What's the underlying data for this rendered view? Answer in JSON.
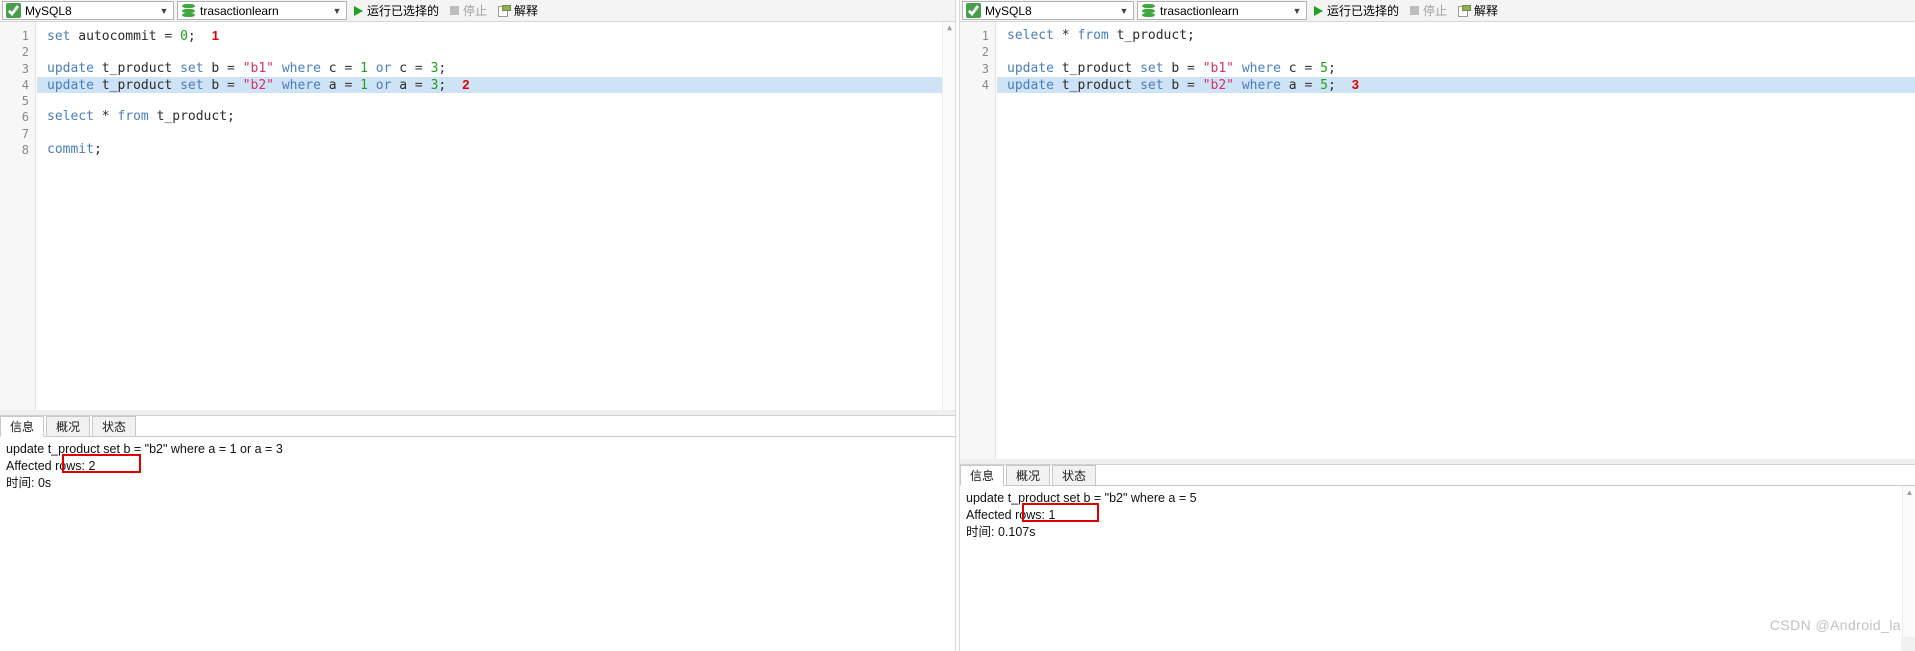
{
  "left_window": {
    "toolbar": {
      "connection": {
        "label": "MySQL8",
        "icon": "mysql-icon"
      },
      "database": {
        "label": "trasactionlearn",
        "icon": "database-icon"
      },
      "run_selected": {
        "label": "运行已选择的",
        "icon": "play-icon"
      },
      "stop": {
        "label": "停止",
        "icon": "stop-icon"
      },
      "explain": {
        "label": "解释",
        "icon": "explain-icon"
      }
    },
    "editor": {
      "line_numbers": [
        "1",
        "2",
        "3",
        "4",
        "5",
        "6",
        "7",
        "8"
      ],
      "lines": [
        {
          "n": 1,
          "tokens": [
            {
              "t": "set",
              "c": "kw"
            },
            {
              "t": " autocommit ",
              "c": "plain"
            },
            {
              "t": "= ",
              "c": "op"
            },
            {
              "t": "0",
              "c": "num"
            },
            {
              "t": ";",
              "c": "plain"
            }
          ],
          "annotation": "1",
          "highlight": false
        },
        {
          "n": 2,
          "tokens": [],
          "annotation": "",
          "highlight": false
        },
        {
          "n": 3,
          "tokens": [
            {
              "t": "update",
              "c": "kw"
            },
            {
              "t": " t_product ",
              "c": "plain"
            },
            {
              "t": "set",
              "c": "kw"
            },
            {
              "t": " b ",
              "c": "plain"
            },
            {
              "t": "= ",
              "c": "op"
            },
            {
              "t": "\"b1\"",
              "c": "str"
            },
            {
              "t": " ",
              "c": "plain"
            },
            {
              "t": "where",
              "c": "kw"
            },
            {
              "t": " c ",
              "c": "plain"
            },
            {
              "t": "= ",
              "c": "op"
            },
            {
              "t": "1",
              "c": "num"
            },
            {
              "t": " ",
              "c": "plain"
            },
            {
              "t": "or",
              "c": "kw"
            },
            {
              "t": " c ",
              "c": "plain"
            },
            {
              "t": "= ",
              "c": "op"
            },
            {
              "t": "3",
              "c": "num"
            },
            {
              "t": ";",
              "c": "plain"
            }
          ],
          "annotation": "",
          "highlight": false
        },
        {
          "n": 4,
          "tokens": [
            {
              "t": "update",
              "c": "kw"
            },
            {
              "t": " t_product ",
              "c": "plain"
            },
            {
              "t": "set",
              "c": "kw"
            },
            {
              "t": " b ",
              "c": "plain"
            },
            {
              "t": "= ",
              "c": "op"
            },
            {
              "t": "\"b2\"",
              "c": "str"
            },
            {
              "t": " ",
              "c": "plain"
            },
            {
              "t": "where",
              "c": "kw"
            },
            {
              "t": " a ",
              "c": "plain"
            },
            {
              "t": "= ",
              "c": "op"
            },
            {
              "t": "1",
              "c": "num"
            },
            {
              "t": " ",
              "c": "plain"
            },
            {
              "t": "or",
              "c": "kw"
            },
            {
              "t": " a ",
              "c": "plain"
            },
            {
              "t": "= ",
              "c": "op"
            },
            {
              "t": "3",
              "c": "num"
            },
            {
              "t": ";",
              "c": "plain"
            }
          ],
          "annotation": "2",
          "highlight": true
        },
        {
          "n": 5,
          "tokens": [],
          "annotation": "",
          "highlight": false
        },
        {
          "n": 6,
          "tokens": [
            {
              "t": "select",
              "c": "kw"
            },
            {
              "t": " ",
              "c": "plain"
            },
            {
              "t": "*",
              "c": "star"
            },
            {
              "t": " ",
              "c": "plain"
            },
            {
              "t": "from",
              "c": "kw"
            },
            {
              "t": " t_product;",
              "c": "plain"
            }
          ],
          "annotation": "",
          "highlight": false
        },
        {
          "n": 7,
          "tokens": [],
          "annotation": "",
          "highlight": false
        },
        {
          "n": 8,
          "tokens": [
            {
              "t": "commit",
              "c": "kw"
            },
            {
              "t": ";",
              "c": "plain"
            }
          ],
          "annotation": "",
          "highlight": false
        }
      ]
    },
    "results": {
      "tabs": [
        {
          "label": "信息",
          "active": true
        },
        {
          "label": "概况",
          "active": false
        },
        {
          "label": "状态",
          "active": false
        }
      ],
      "statement": "update t_product set b = \"b2\" where a = 1 or a = 3",
      "affected_rows": "Affected rows: 2",
      "elapsed": "时间: 0s"
    }
  },
  "right_window": {
    "toolbar": {
      "connection": {
        "label": "MySQL8",
        "icon": "mysql-icon"
      },
      "database": {
        "label": "trasactionlearn",
        "icon": "database-icon"
      },
      "run_selected": {
        "label": "运行已选择的",
        "icon": "play-icon"
      },
      "stop": {
        "label": "停止",
        "icon": "stop-icon"
      },
      "explain": {
        "label": "解释",
        "icon": "explain-icon"
      }
    },
    "editor": {
      "line_numbers": [
        "1",
        "2",
        "3",
        "4"
      ],
      "lines": [
        {
          "n": 1,
          "tokens": [
            {
              "t": "select",
              "c": "kw"
            },
            {
              "t": " ",
              "c": "plain"
            },
            {
              "t": "*",
              "c": "star"
            },
            {
              "t": " ",
              "c": "plain"
            },
            {
              "t": "from",
              "c": "kw"
            },
            {
              "t": " t_product;",
              "c": "plain"
            }
          ],
          "annotation": "",
          "highlight": false
        },
        {
          "n": 2,
          "tokens": [],
          "annotation": "",
          "highlight": false
        },
        {
          "n": 3,
          "tokens": [
            {
              "t": "update",
              "c": "kw"
            },
            {
              "t": " t_product ",
              "c": "plain"
            },
            {
              "t": "set",
              "c": "kw"
            },
            {
              "t": " b ",
              "c": "plain"
            },
            {
              "t": "= ",
              "c": "op"
            },
            {
              "t": "\"b1\"",
              "c": "str"
            },
            {
              "t": " ",
              "c": "plain"
            },
            {
              "t": "where",
              "c": "kw"
            },
            {
              "t": " c ",
              "c": "plain"
            },
            {
              "t": "= ",
              "c": "op"
            },
            {
              "t": "5",
              "c": "num"
            },
            {
              "t": ";",
              "c": "plain"
            }
          ],
          "annotation": "",
          "highlight": false
        },
        {
          "n": 4,
          "tokens": [
            {
              "t": "update",
              "c": "kw"
            },
            {
              "t": " t_product ",
              "c": "plain"
            },
            {
              "t": "set",
              "c": "kw"
            },
            {
              "t": " b ",
              "c": "plain"
            },
            {
              "t": "= ",
              "c": "op"
            },
            {
              "t": "\"b2\"",
              "c": "str"
            },
            {
              "t": " ",
              "c": "plain"
            },
            {
              "t": "where",
              "c": "kw"
            },
            {
              "t": " a ",
              "c": "plain"
            },
            {
              "t": "= ",
              "c": "op"
            },
            {
              "t": "5",
              "c": "num"
            },
            {
              "t": ";",
              "c": "plain"
            }
          ],
          "annotation": "3",
          "highlight": true
        }
      ]
    },
    "results": {
      "tabs": [
        {
          "label": "信息",
          "active": true
        },
        {
          "label": "概况",
          "active": false
        },
        {
          "label": "状态",
          "active": false
        }
      ],
      "statement": "update t_product set b = \"b2\" where a = 5",
      "affected_rows": "Affected rows: 1",
      "elapsed": "时间: 0.107s"
    }
  },
  "watermark": "CSDN @Android_la",
  "colors": {
    "keyword": "#4a7ebb",
    "string": "#d1326a",
    "number": "#1ba11b",
    "annotation": "#e00000",
    "selection": "#cfe3f7",
    "accent_green": "#21a121"
  }
}
